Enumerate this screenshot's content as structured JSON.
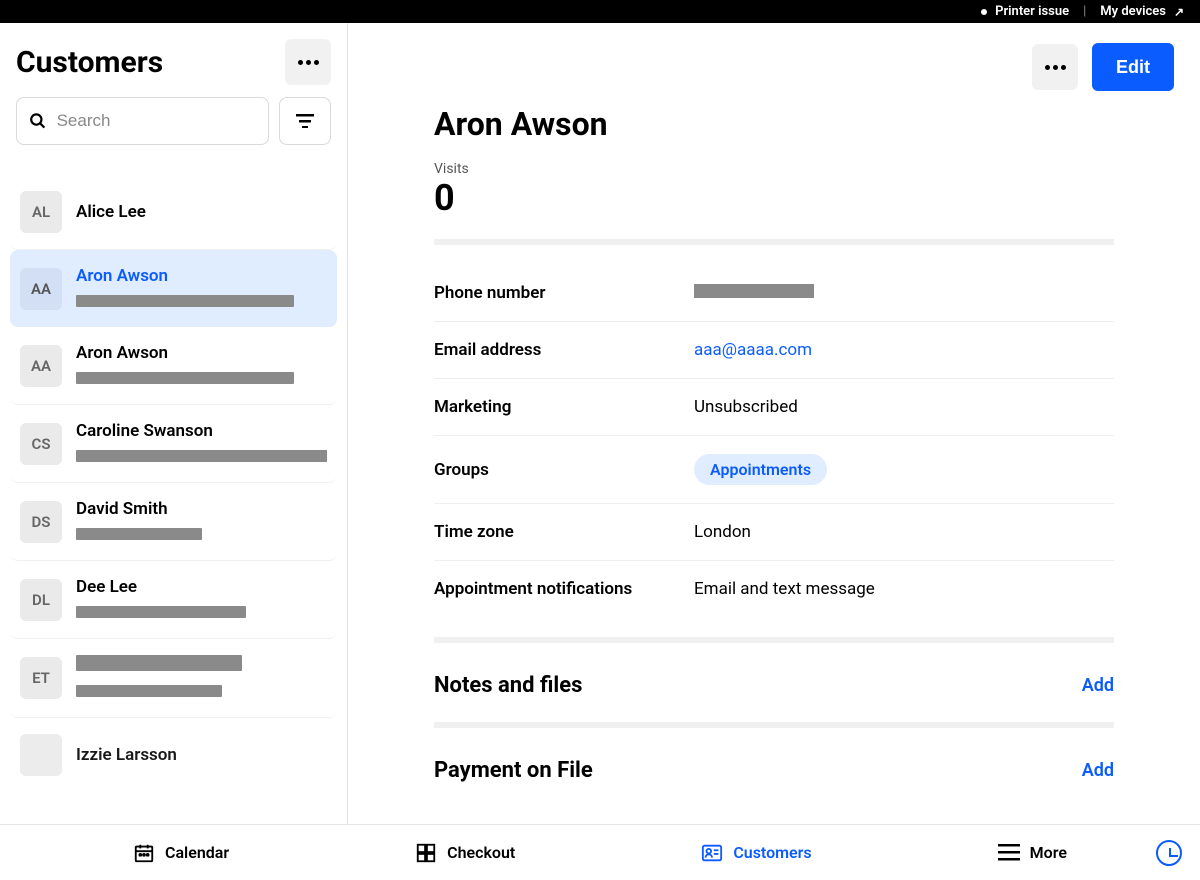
{
  "topbar": {
    "alert": "Printer issue",
    "devices": "My devices"
  },
  "sidebar": {
    "title": "Customers",
    "search_placeholder": "Search",
    "customers": [
      {
        "initials": "AL",
        "name": "Alice Lee",
        "redacted_w": 0,
        "selected": false
      },
      {
        "initials": "AA",
        "name": "Aron Awson",
        "redacted_w": 218,
        "selected": true
      },
      {
        "initials": "AA",
        "name": "Aron Awson",
        "redacted_w": 218,
        "selected": false
      },
      {
        "initials": "CS",
        "name": "Caroline Swanson",
        "redacted_w": 252,
        "selected": false
      },
      {
        "initials": "DS",
        "name": "David Smith",
        "redacted_w": 126,
        "selected": false
      },
      {
        "initials": "DL",
        "name": "Dee Lee",
        "redacted_w": 170,
        "selected": false
      },
      {
        "initials": "ET",
        "name": "",
        "redacted_w": 146,
        "redacted_name_w": 166,
        "selected": false
      },
      {
        "initials": "",
        "name": "Izzie Larsson",
        "redacted_w": 0,
        "selected": false,
        "partial": true
      }
    ]
  },
  "detail": {
    "edit_label": "Edit",
    "name": "Aron Awson",
    "visits_label": "Visits",
    "visits_value": "0",
    "fields": {
      "phone_label": "Phone number",
      "email_label": "Email address",
      "email_value": "aaa@aaaa.com",
      "marketing_label": "Marketing",
      "marketing_value": "Unsubscribed",
      "groups_label": "Groups",
      "groups_value": "Appointments",
      "timezone_label": "Time zone",
      "timezone_value": "London",
      "notif_label": "Appointment notifications",
      "notif_value": "Email and text message"
    },
    "notes_title": "Notes and files",
    "notes_add": "Add",
    "payment_title": "Payment on File",
    "payment_add": "Add"
  },
  "nav": {
    "calendar": "Calendar",
    "checkout": "Checkout",
    "customers": "Customers",
    "more": "More"
  }
}
